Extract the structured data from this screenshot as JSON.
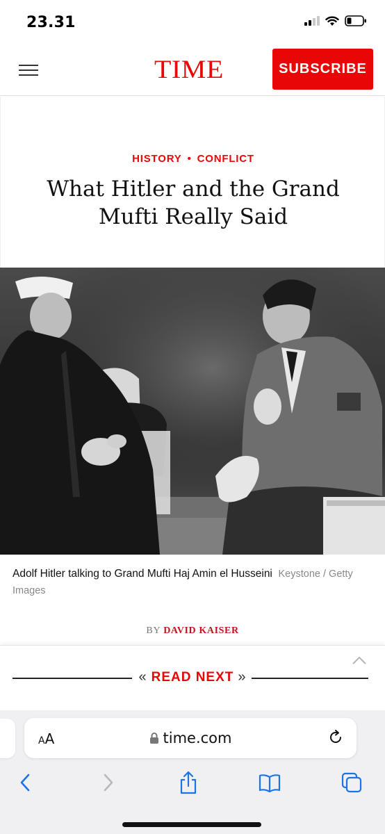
{
  "status_bar": {
    "time": "23.31"
  },
  "header": {
    "logo": "TIME",
    "subscribe_label": "SUBSCRIBE"
  },
  "article": {
    "tags": [
      "HISTORY",
      "CONFLICT"
    ],
    "tag_separator": "•",
    "headline": "What Hitler and the Grand Mufti Really Said",
    "caption": "Adolf Hitler talking to Grand Mufti Haj Amin el Husseini",
    "credit": "Keystone / Getty Images",
    "byline_prefix": "BY",
    "author": "DAVID KAISER"
  },
  "read_next": {
    "label": "READ NEXT"
  },
  "browser": {
    "text_size_label": "AA",
    "url": "time.com"
  },
  "colors": {
    "brand_red": "#e90606",
    "safari_blue": "#1a73e8"
  }
}
